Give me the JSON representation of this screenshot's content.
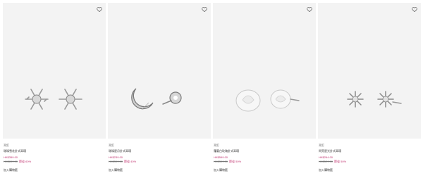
{
  "products": [
    {
      "category": "耳釘",
      "name": "璀璨雪花針式耳環",
      "price": "HK$359.00",
      "original_price": "HK$899.00",
      "save": "節省 60%",
      "add_to_cart": "加入購物籃",
      "wishlist_icon": "heart-outline-icon",
      "image": "snowflake-stud-earrings"
    },
    {
      "category": "耳釘",
      "name": "璀璨星月針式耳環",
      "price": "HK$239.00",
      "original_price": "HK$399.00",
      "save": "節省 40%",
      "add_to_cart": "加入購物籃",
      "wishlist_icon": "heart-outline-icon",
      "image": "moon-star-stud-earrings"
    },
    {
      "category": "耳釘",
      "name": "蘿蔔白玫瑰針式耳環",
      "price": "HK$599.00",
      "original_price": "HK$399.00",
      "save": "節省 50%",
      "add_to_cart": "加入購物籃",
      "wishlist_icon": "heart-outline-icon",
      "image": "white-rose-stud-earrings"
    },
    {
      "category": "耳釘",
      "name": "閃亮星光針式耳環",
      "price": "HK$264.00",
      "original_price": "HK$529.00",
      "save": "節省 50%",
      "add_to_cart": "加入購物籃",
      "wishlist_icon": "heart-outline-icon",
      "image": "sparkle-star-stud-earrings"
    }
  ],
  "colors": {
    "image_bg": "#f3f3f3",
    "price": "#c0336f",
    "text": "#333333"
  }
}
